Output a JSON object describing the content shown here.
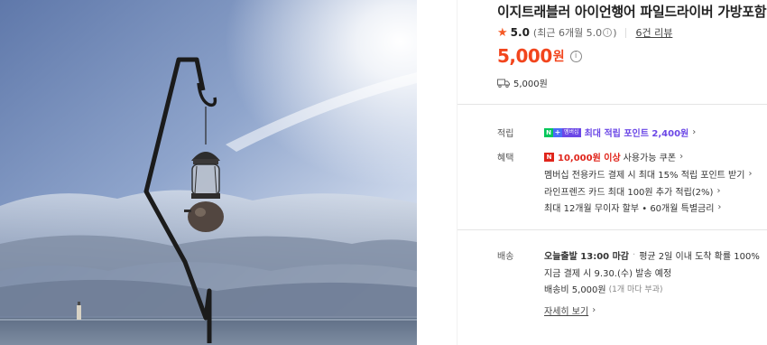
{
  "product": {
    "title": "이지트래블러 아이언행어 파일드라이버 가방포함",
    "rating": {
      "star": "★",
      "value": "5.0",
      "note_prefix": "(최근 6개월 5.0",
      "note_suffix": ")",
      "reviews_label": "6건 리뷰"
    },
    "price": {
      "amount": "5,000",
      "unit": "원"
    },
    "shipping_fee": "5,000원"
  },
  "benefits": {
    "points_label": "적립",
    "points_badge_n": "N",
    "points_badge_plus": "+",
    "points_badge_member": "멤버십",
    "points_text": "최대 적립 포인트 2,400원",
    "benefit_label": "혜택",
    "coupon_badge": "N",
    "coupon_amount": "10,000원 이상",
    "coupon_text": "사용가능 쿠폰",
    "lines": [
      "멤버십 전용카드 결제 시 최대 15% 적립 포인트 받기",
      "라인프렌즈 카드 최대 100원 추가 적립(2%)",
      "최대 12개월 무이자 할부 • 60개월 특별금리"
    ]
  },
  "delivery": {
    "label": "배송",
    "today": "오늘출발 13:00 마감",
    "dot": "·",
    "arrival": "평균 2일 이내 도착 확률 100%",
    "payment_line": "지금 결제 시 9.30.(수) 발송 예정",
    "fee_text": "배송비 5,000원",
    "fee_note": "(1개 마다 부과)",
    "detail_link": "자세히 보기"
  },
  "icons": {
    "chevron": "›",
    "info": "i"
  },
  "colors": {
    "price_red": "#f2451d",
    "star_orange": "#f55a26",
    "naver_green": "#03c75a",
    "membership_purple": "#6b47e6",
    "coupon_red": "#e0251b"
  }
}
